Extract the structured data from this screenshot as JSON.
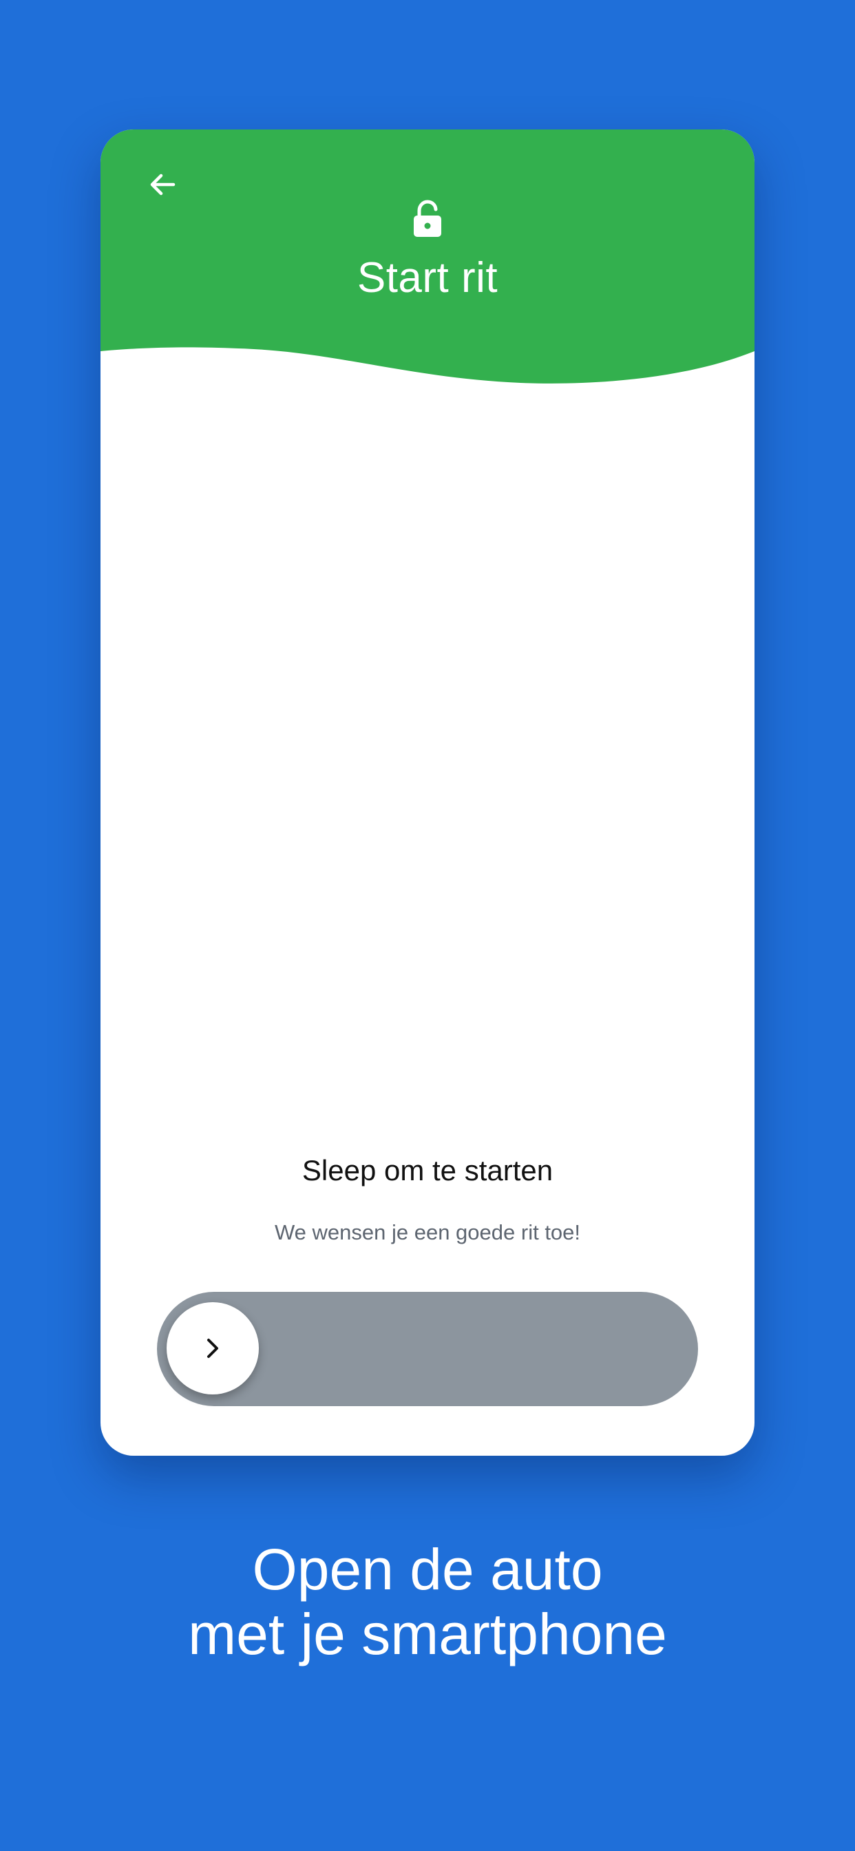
{
  "colors": {
    "background": "#1f6fd9",
    "header": "#33b04e",
    "card": "#ffffff",
    "slider_track": "#8c959e",
    "slider_knob": "#ffffff"
  },
  "header": {
    "back_icon": "arrow-left-icon",
    "lock_icon": "lock-open-icon",
    "title": "Start rit"
  },
  "content": {
    "slide_title": "Sleep om te starten",
    "slide_subtitle": "We wensen je een goede rit toe!"
  },
  "slider": {
    "knob_icon": "chevron-right-icon",
    "progress": 0
  },
  "tagline": {
    "line1": "Open de auto",
    "line2": "met je smartphone"
  }
}
